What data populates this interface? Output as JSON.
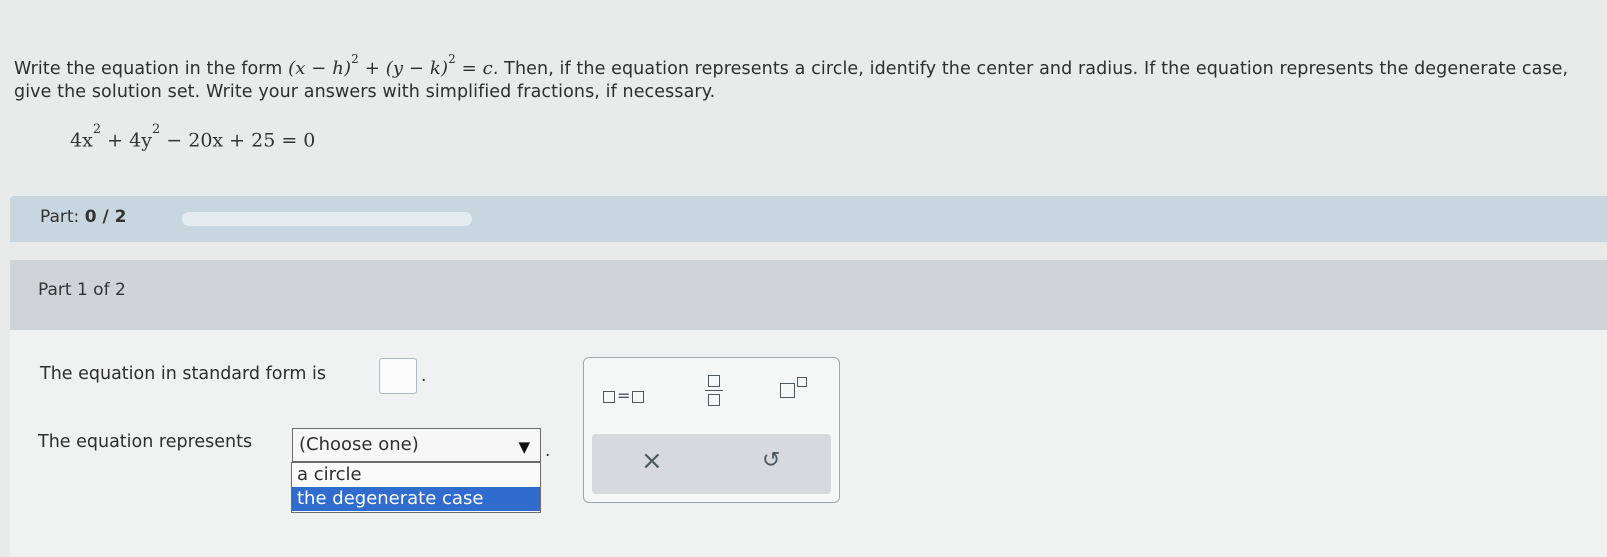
{
  "problem": {
    "intro": "Write the equation in the form",
    "form_h": "(x − h)",
    "form_k": "(y − k)",
    "form_exp": "2",
    "form_plus": "+",
    "form_equals": "= c",
    "rest": ". Then, if the equation represents a circle, identify the center and radius. If the equation represents the degenerate case, give the solution set. Write your answers with simplified fractions, if necessary."
  },
  "equation": {
    "t1": "4x",
    "t2": "+ 4y",
    "t3": "− 20x + 25 = 0",
    "exp": "2"
  },
  "part_bar": {
    "label": "Part:",
    "progress_text": "0 / 2",
    "progress_fraction": 0
  },
  "part1": {
    "header": "Part 1 of 2",
    "q1_text": "The equation in standard form is",
    "q1_period": ".",
    "q2_text": "The equation represents",
    "select_value": "(Choose one)",
    "select_arrow": "▼",
    "q2_period": ".",
    "options": [
      "a circle",
      "the degenerate case"
    ],
    "selected_option_index": 1
  },
  "palette": {
    "equals_label": "=",
    "clear_symbol": "×",
    "undo_symbol": "↺"
  },
  "colors": {
    "selected_option": "#2f6ccd",
    "part_bar": "#c7d6df"
  }
}
